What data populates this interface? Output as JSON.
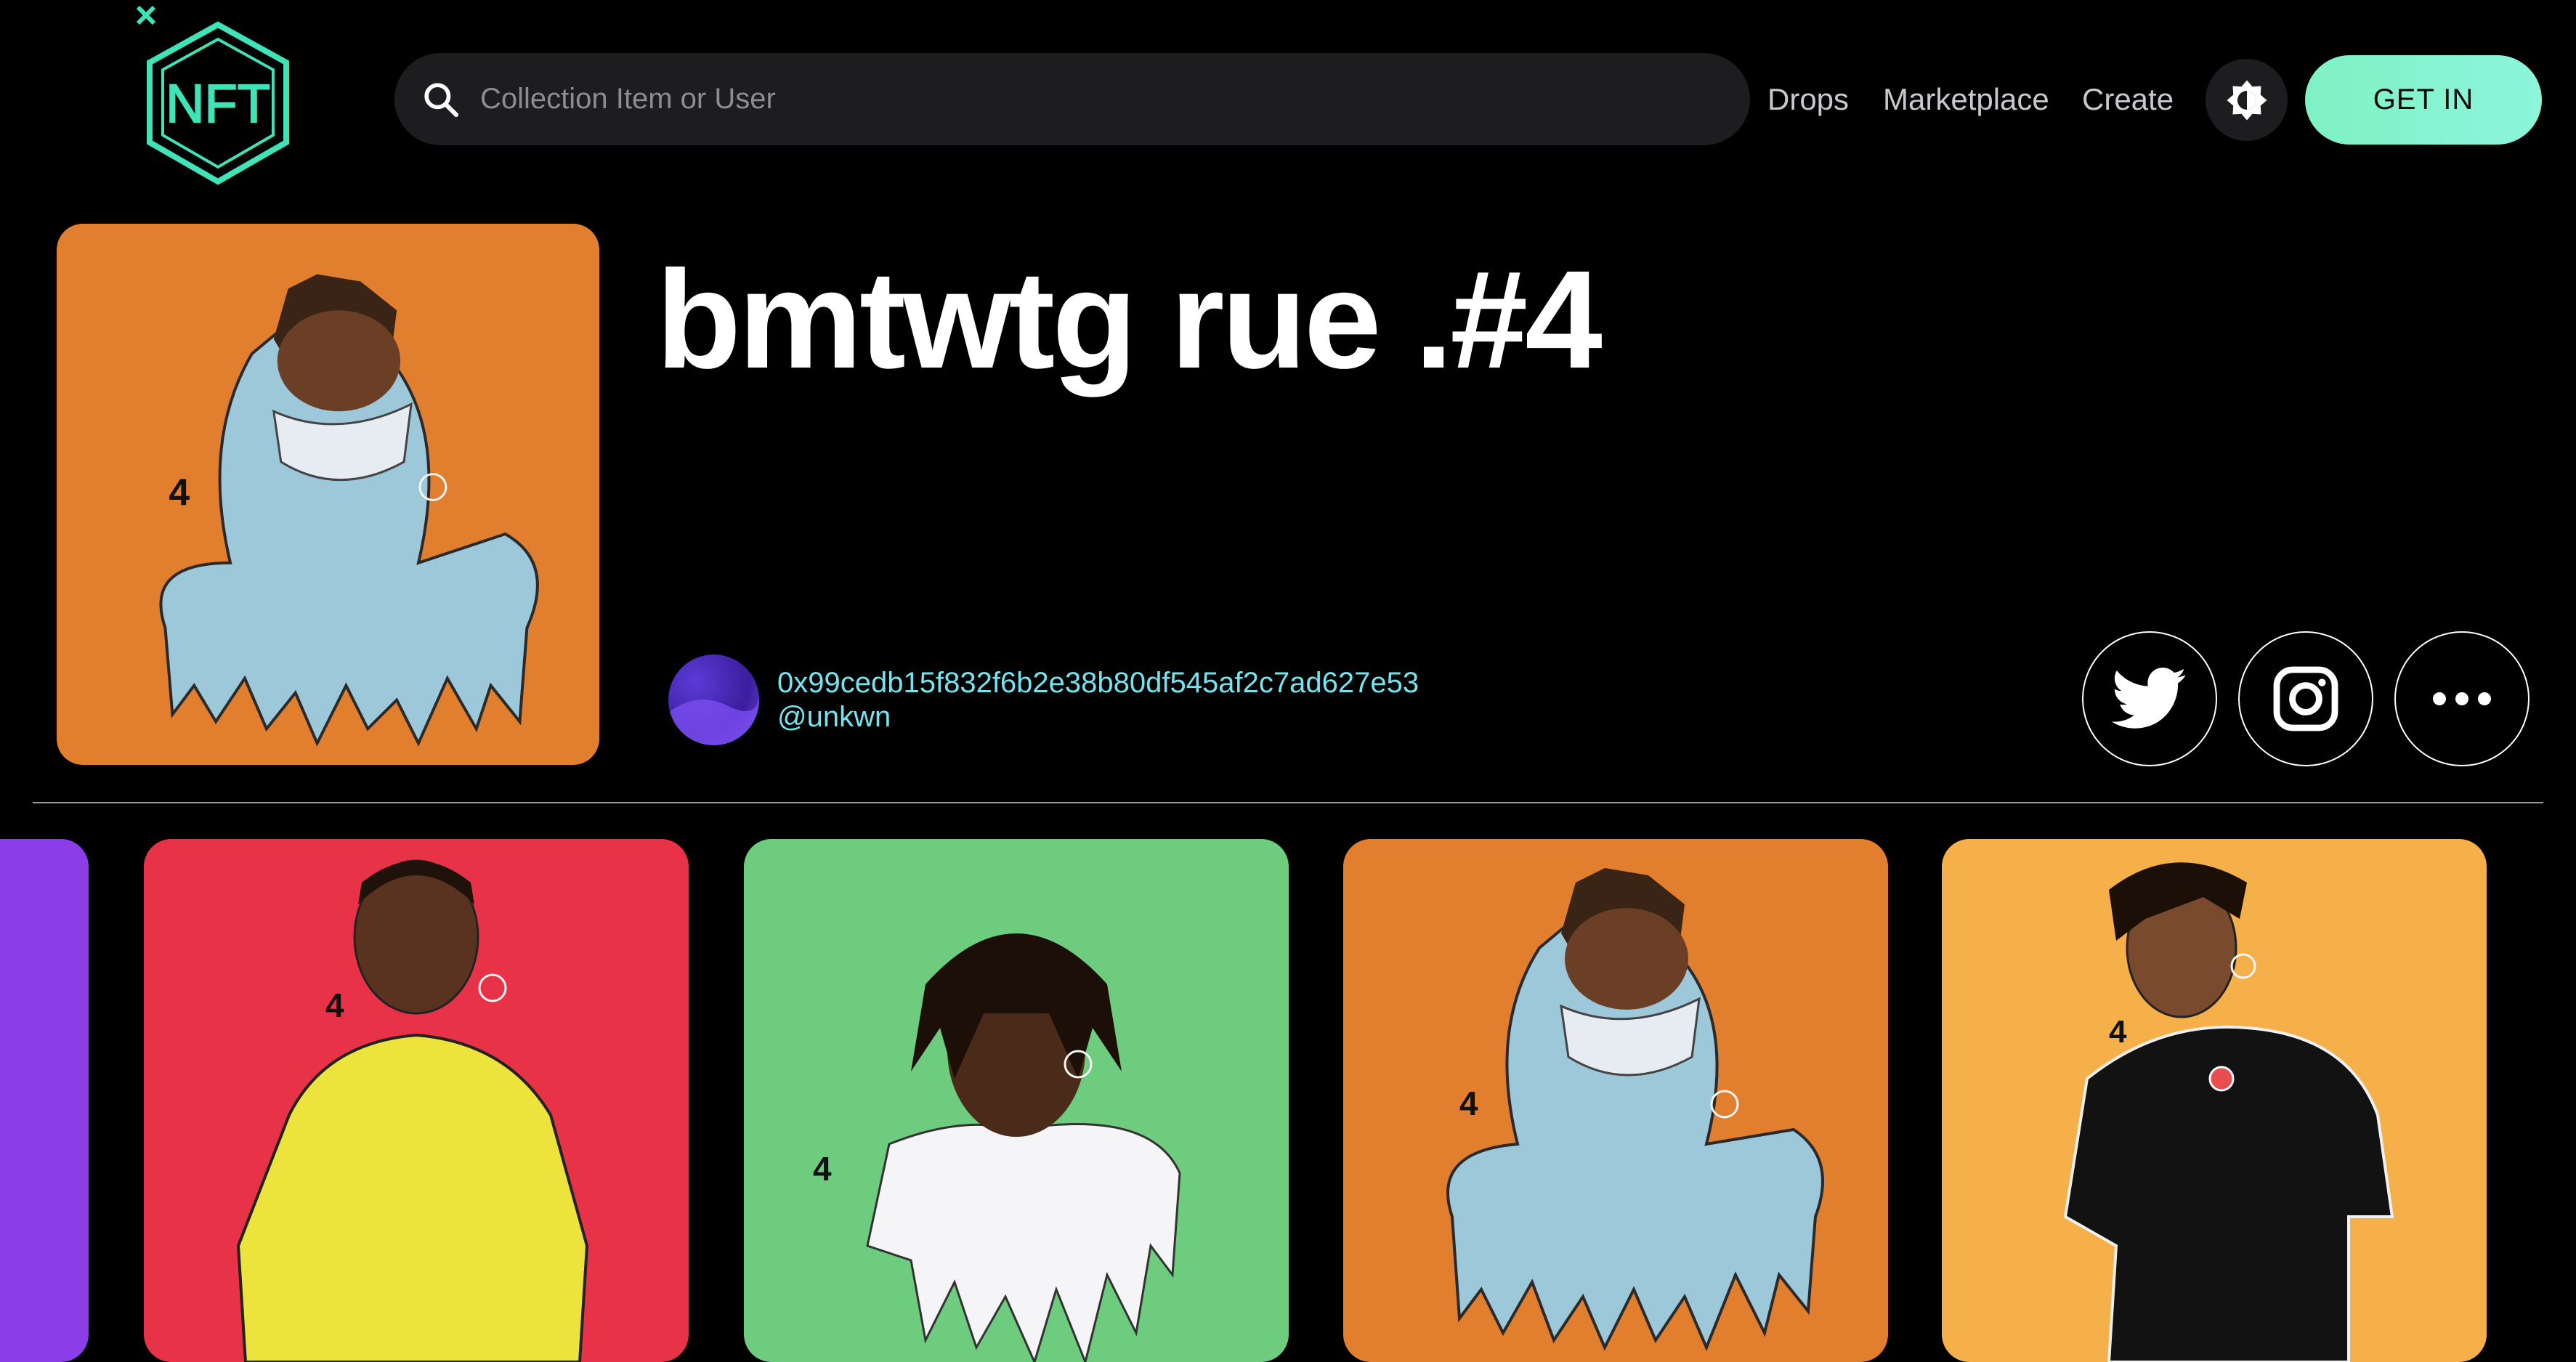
{
  "header": {
    "logo_text": "NFT",
    "search_placeholder": "Collection Item or User",
    "nav": [
      "Drops",
      "Marketplace",
      "Create"
    ],
    "cta_label": "GET IN",
    "icons": {
      "search": "search-icon",
      "theme": "brightness-icon"
    }
  },
  "item": {
    "title": "bmtwtg rue .#4",
    "owner_address": "0x99cedb15f832f6b2e38b80df545af2c7ad627e53",
    "owner_handle": "@unkwn",
    "social": [
      "twitter-icon",
      "instagram-icon",
      "more-icon"
    ]
  },
  "gallery": {
    "cards": [
      {
        "name": "purple-card",
        "bg": "#8a3ee8"
      },
      {
        "name": "red-card",
        "bg": "#e73247"
      },
      {
        "name": "green-card",
        "bg": "#6dcc7e"
      },
      {
        "name": "orange-card",
        "bg": "#e27f2e"
      },
      {
        "name": "yellow-card",
        "bg": "#f5b04a"
      }
    ]
  },
  "colors": {
    "background": "#000000",
    "accent": "#7ff2c4",
    "link": "#76e4ef",
    "search_bg": "#1d1d1f"
  }
}
